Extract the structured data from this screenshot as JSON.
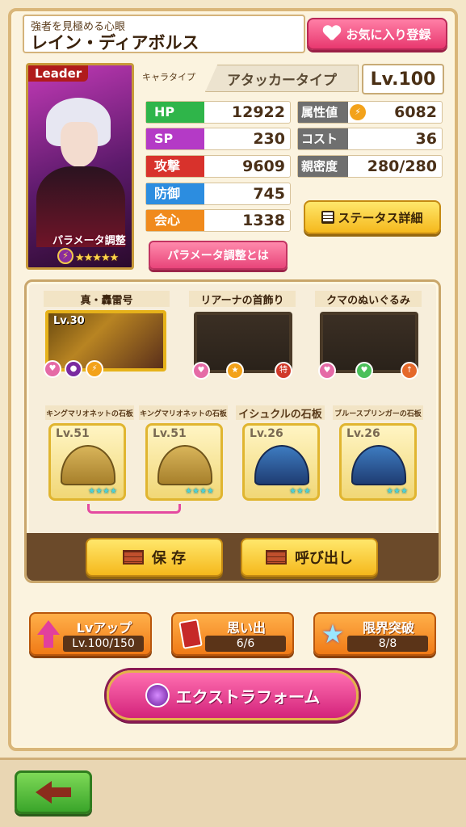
{
  "header": {
    "subtitle": "強者を見極める心眼",
    "name": "レイン・ディアボルス",
    "favorite_label": "お気に入り登録"
  },
  "portrait": {
    "leader_label": "Leader",
    "param_adjust_label": "パラメータ調整",
    "rarity_stars": "★★★★★"
  },
  "chara_type": {
    "label": "キャラタイプ",
    "value": "アタッカータイプ",
    "level": "Lv.100"
  },
  "stats_left": [
    {
      "label": "HP",
      "value": "12922",
      "color": "#2fb54a"
    },
    {
      "label": "SP",
      "value": "230",
      "color": "#b43ac6"
    },
    {
      "label": "攻撃",
      "value": "9609",
      "color": "#d8322c"
    },
    {
      "label": "防御",
      "value": "745",
      "color": "#2c8de0"
    },
    {
      "label": "会心",
      "value": "1338",
      "color": "#f08a1c"
    }
  ],
  "stats_right": [
    {
      "label": "属性値",
      "value": "6082"
    },
    {
      "label": "コスト",
      "value": "36"
    },
    {
      "label": "親密度",
      "value": "280/280"
    }
  ],
  "buttons": {
    "param_about": "パラメータ調整とは",
    "status_detail": "ステータス詳細",
    "save": "保 存",
    "load": "呼び出し"
  },
  "equipment": [
    {
      "name": "真・轟雷号",
      "level": "Lv.30"
    },
    {
      "name": "リアーナの首飾り",
      "level": ""
    },
    {
      "name": "クマのぬいぐるみ",
      "level": ""
    }
  ],
  "stones": [
    {
      "name": "キングマリオネットの石板",
      "level": "Lv.51",
      "stars": "★★★★",
      "type": "gold"
    },
    {
      "name": "キングマリオネットの石板",
      "level": "Lv.51",
      "stars": "★★★★",
      "type": "gold"
    },
    {
      "name": "イシュクルの石板",
      "level": "Lv.26",
      "stars": "★★★",
      "type": "blue"
    },
    {
      "name": "ブルースプリンガーの石板",
      "level": "Lv.26",
      "stars": "★★★",
      "type": "blue"
    }
  ],
  "bottom": {
    "lvup_title": "Lvアップ",
    "lvup_value": "Lv.100/150",
    "memory_title": "思い出",
    "memory_value": "6/6",
    "limit_title": "限界突破",
    "limit_value": "8/8",
    "extra_form": "エクストラフォーム"
  }
}
